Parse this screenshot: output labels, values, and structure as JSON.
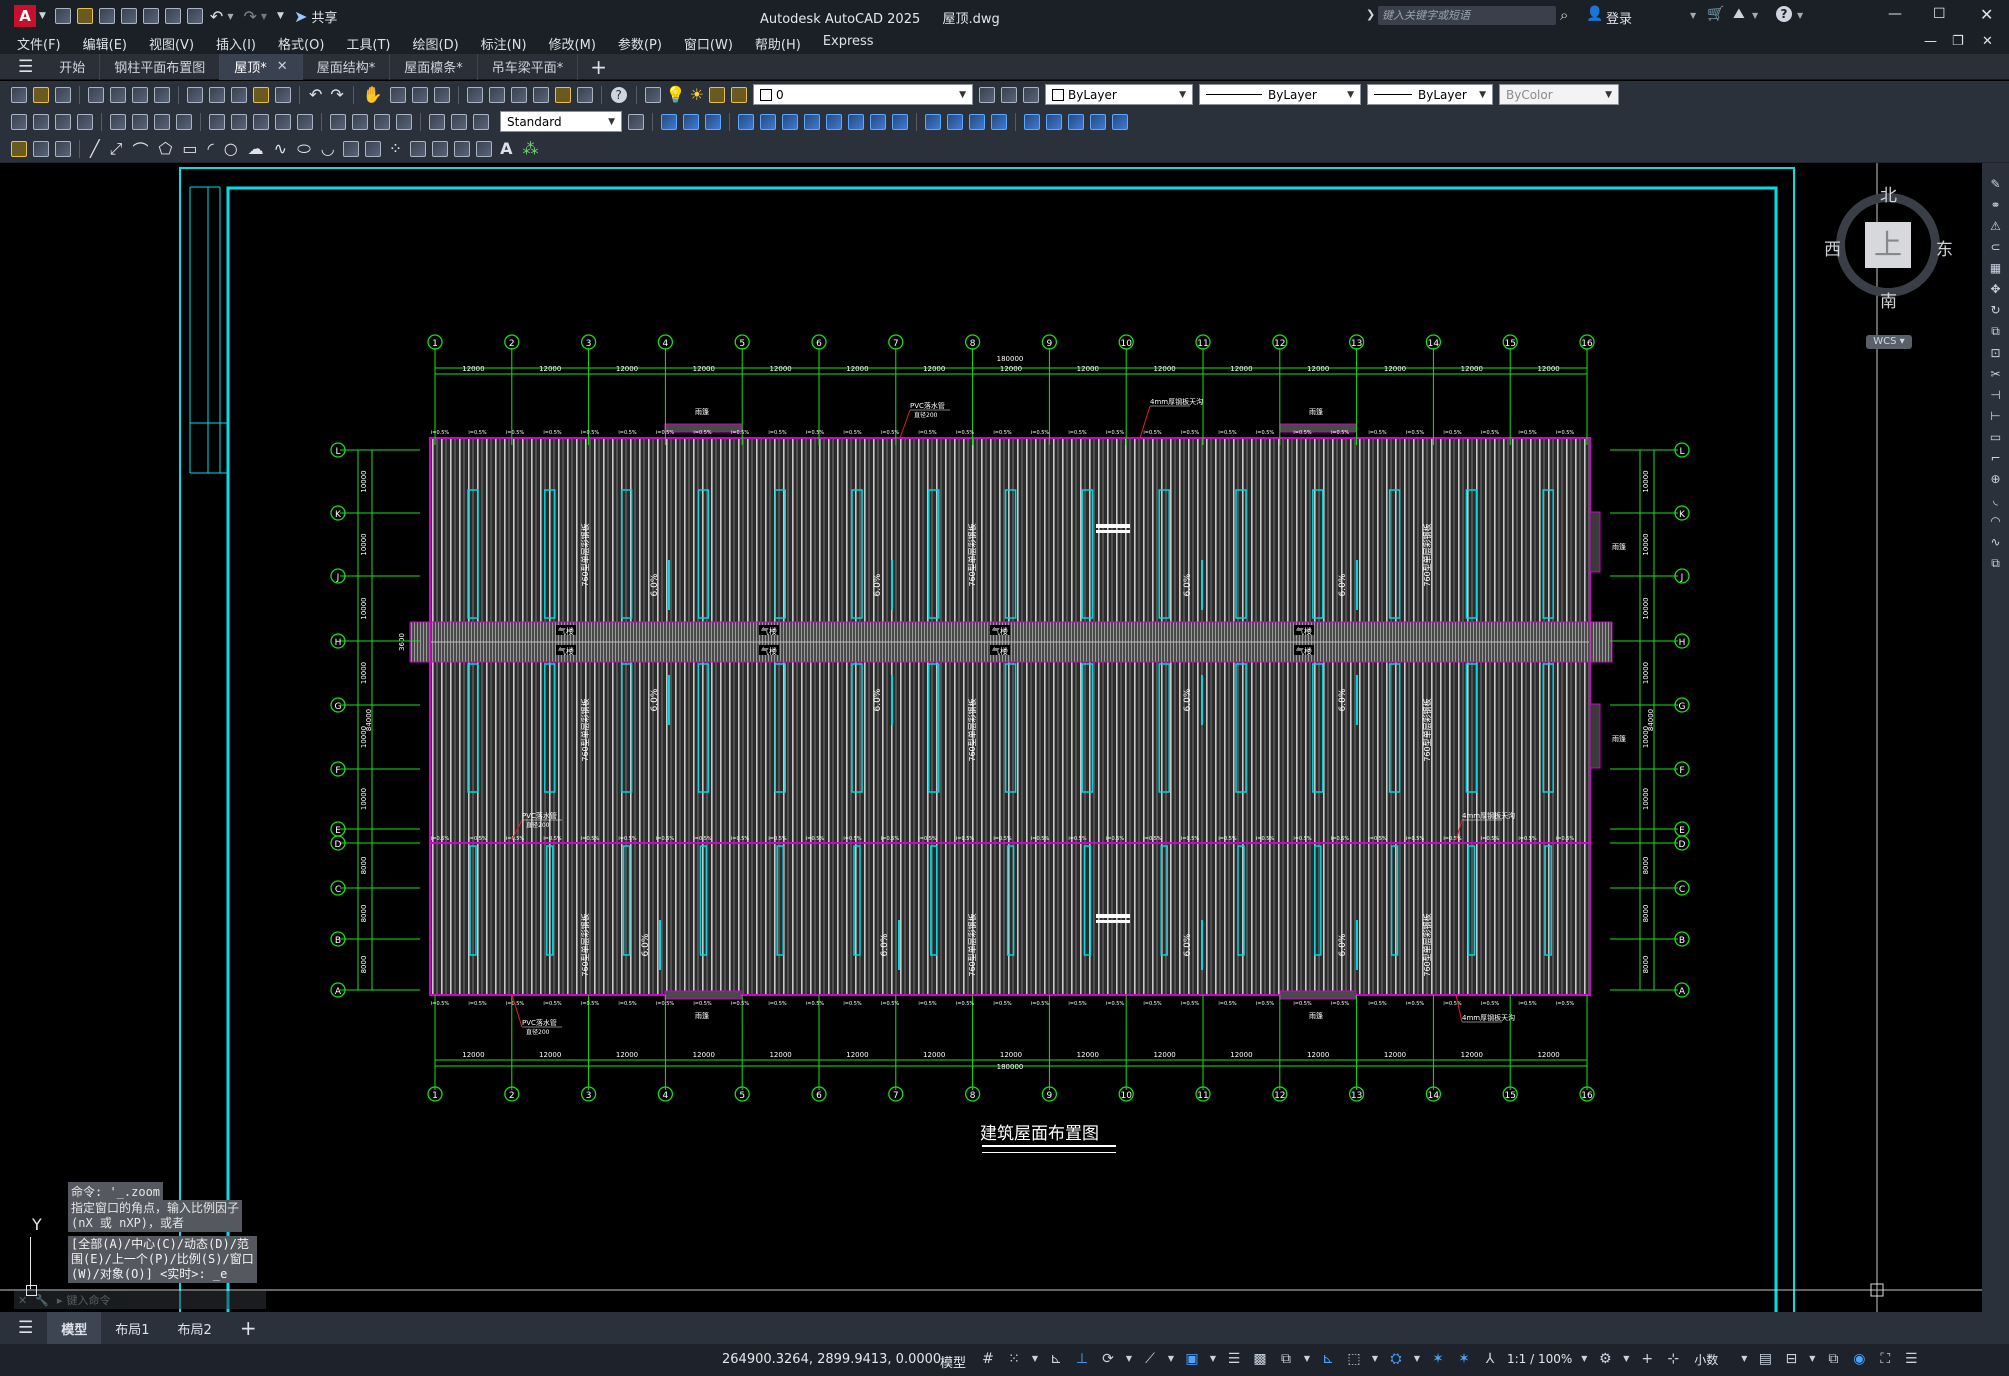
{
  "app": {
    "title": "Autodesk AutoCAD 2025",
    "filename": "屋顶.dwg",
    "logo": "A",
    "share_label": "共享",
    "search_placeholder": "键入关键字或短语",
    "login_label": "登录"
  },
  "menus": [
    "文件(F)",
    "编辑(E)",
    "视图(V)",
    "插入(I)",
    "格式(O)",
    "工具(T)",
    "绘图(D)",
    "标注(N)",
    "修改(M)",
    "参数(P)",
    "窗口(W)",
    "帮助(H)",
    "Express"
  ],
  "doc_tabs": [
    {
      "label": "开始",
      "active": false,
      "closable": false
    },
    {
      "label": "钢柱平面布置图",
      "active": false,
      "closable": false
    },
    {
      "label": "屋顶*",
      "active": true,
      "closable": true
    },
    {
      "label": "屋面结构*",
      "active": false,
      "closable": false
    },
    {
      "label": "屋面檩条*",
      "active": false,
      "closable": false
    },
    {
      "label": "吊车梁平面*",
      "active": false,
      "closable": false
    }
  ],
  "toolbar": {
    "layer_value": "0",
    "color_value": "ByLayer",
    "linetype_value": "ByLayer",
    "lineweight_value": "ByLayer",
    "plotstyle_value": "ByColor",
    "textstyle_value": "Standard"
  },
  "viewcube": {
    "north": "北",
    "south": "南",
    "east": "东",
    "west": "西",
    "face": "上",
    "ucs_label": "WCS"
  },
  "drawing": {
    "title": "建筑屋面布置图",
    "axis_numbers": [
      "1",
      "2",
      "3",
      "4",
      "5",
      "6",
      "7",
      "8",
      "9",
      "10",
      "11",
      "12",
      "13",
      "14",
      "15",
      "16"
    ],
    "axis_letters": [
      "L",
      "K",
      "J",
      "H",
      "G",
      "F",
      "E",
      "D",
      "C",
      "B",
      "A"
    ],
    "bay_dim": "12000",
    "total_dim": "180000",
    "row_dims": [
      "10000",
      "10000",
      "10000",
      "10000",
      "10000",
      "10000",
      "10000",
      "8000",
      "8000",
      "8000"
    ],
    "total_row_dim": "84000",
    "gutter_dim": "3600",
    "ridge_labels": [
      "气楼",
      "气楼",
      "气楼",
      "气楼"
    ],
    "panel_label": "760型单层彩钢板",
    "slope_label": "6.0%",
    "pvc_note": "PVC落水管",
    "pvc_sub": "直径200",
    "gutter_note": "4mm厚钢板天沟",
    "rain_note": "雨篷",
    "grade_marks": [
      "i=0.5%"
    ]
  },
  "command": {
    "history": [
      "命令: '_.zoom"
    ],
    "prompt_lines": [
      "指定窗口的角点，输入比例因子",
      "(nX 或 nXP)，或者"
    ],
    "options_lines": [
      "[全部(A)/中心(C)/动态(D)/范",
      "围(E)/上一个(P)/比例(S)/窗口",
      "(W)/对象(O)] <实时>: _e"
    ],
    "input_placeholder": "键入命令"
  },
  "ucs": {
    "y_label": "Y"
  },
  "layout_tabs": [
    {
      "label": "模型",
      "active": true
    },
    {
      "label": "布局1",
      "active": false
    },
    {
      "label": "布局2",
      "active": false
    }
  ],
  "status": {
    "coords": "264900.3264, 2899.9413, 0.0000",
    "model": "模型",
    "scale": "1:1 / 100%",
    "units": "小数"
  }
}
